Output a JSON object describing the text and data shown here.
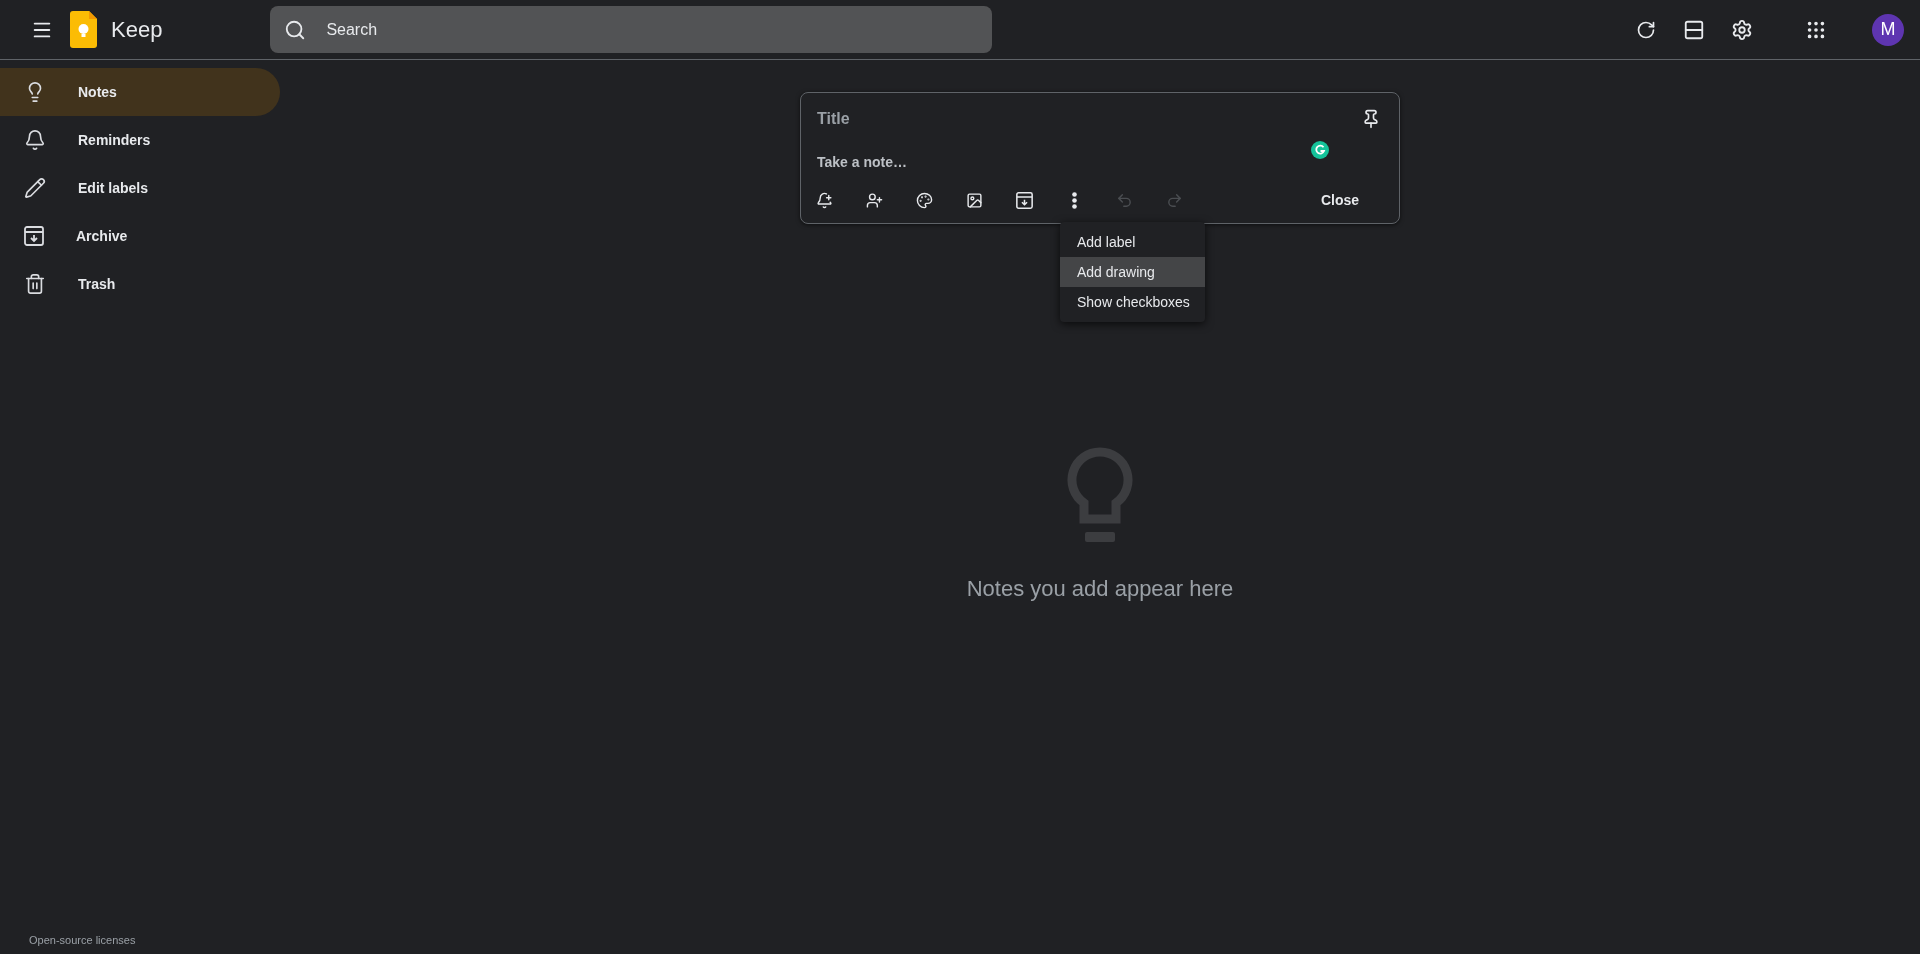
{
  "header": {
    "app_name": "Keep",
    "search": {
      "placeholder": "Search"
    },
    "avatar": "M"
  },
  "sidebar": {
    "items": [
      {
        "kind": "notes",
        "label": "Notes",
        "selected": true
      },
      {
        "kind": "reminders",
        "label": "Reminders",
        "selected": false
      },
      {
        "kind": "edit",
        "label": "Edit labels",
        "selected": false
      },
      {
        "kind": "archive",
        "label": "Archive",
        "selected": false
      },
      {
        "kind": "trash",
        "label": "Trash",
        "selected": false
      }
    ],
    "footer_link": "Open-source licenses"
  },
  "note_editor": {
    "title_placeholder": "Title",
    "body_placeholder": "Take a note…",
    "toolbar": [
      {
        "kind": "reminder",
        "disabled": false
      },
      {
        "kind": "collaborator",
        "disabled": false
      },
      {
        "kind": "palette",
        "disabled": false
      },
      {
        "kind": "image",
        "disabled": false
      },
      {
        "kind": "archive",
        "disabled": false
      },
      {
        "kind": "more",
        "disabled": false
      },
      {
        "kind": "undo",
        "disabled": true
      },
      {
        "kind": "redo",
        "disabled": true
      }
    ],
    "close_button": "Close",
    "menu": [
      {
        "label": "Add label",
        "selected": false
      },
      {
        "label": "Add drawing",
        "selected": true
      },
      {
        "label": "Show checkboxes",
        "selected": false
      }
    ]
  },
  "empty_state": {
    "message": "Notes you add appear here"
  }
}
